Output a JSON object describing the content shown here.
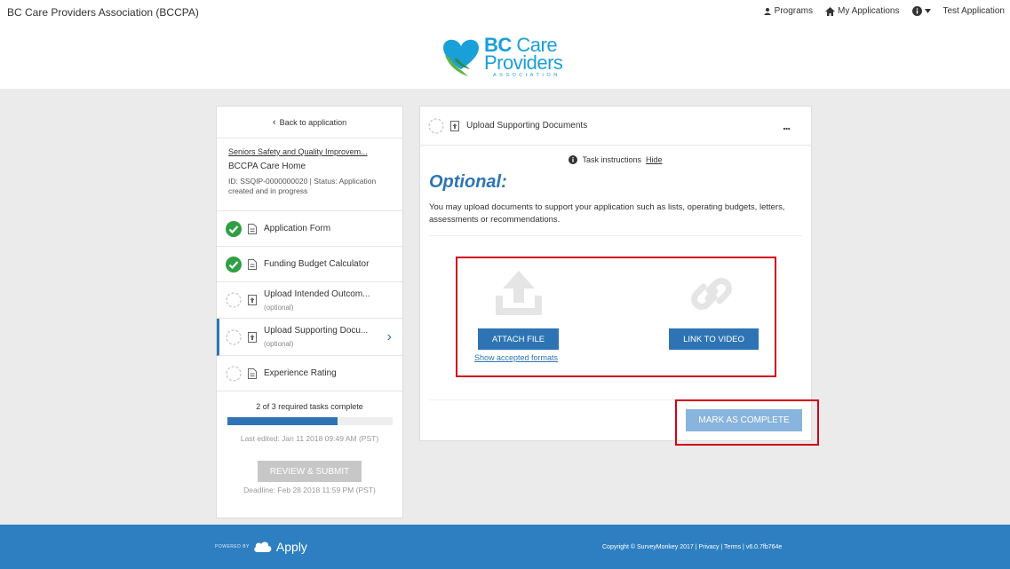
{
  "header": {
    "org_name": "BC Care Providers Association (BCCPA)",
    "nav": {
      "programs": "Programs",
      "my_applications": "My Applications",
      "account": "Test Application"
    },
    "logo": {
      "line1_bold": "BC",
      "line1_rest": "Care",
      "line2": "Providers",
      "line3": "ASSOCIATION"
    }
  },
  "sidebar": {
    "back_label": "Back to application",
    "program": "Seniors Safety and Quality Improvem...",
    "app_name": "BCCPA Care Home",
    "status": "ID: SSQIP-0000000020 | Status: Application created and in progress",
    "tasks": [
      {
        "label": "Application Form",
        "sub": "",
        "status": "complete"
      },
      {
        "label": "Funding Budget Calculator",
        "sub": "",
        "status": "complete"
      },
      {
        "label": "Upload Intended Outcom...",
        "sub": "(optional)",
        "status": "pending"
      },
      {
        "label": "Upload Supporting Docu...",
        "sub": "(optional)",
        "status": "pending",
        "active": true
      },
      {
        "label": "Experience Rating",
        "sub": "",
        "status": "pending"
      }
    ],
    "progress_text": "2 of 3 required tasks complete",
    "progress_fraction": 0.667,
    "last_edited": "Last edited: Jan 11 2018 09:49 AM (PST)",
    "review_label": "REVIEW & SUBMIT",
    "deadline": "Deadline: Feb 28 2018 11:59 PM (PST)"
  },
  "main": {
    "title": "Upload Supporting Documents",
    "more_label": "...",
    "instructions_label": "Task instructions",
    "hide_label": "Hide",
    "optional_heading": "Optional:",
    "description": "You may upload documents to support your application such as lists, operating budgets, letters, assessments or recommendations.",
    "attach_label": "ATTACH FILE",
    "formats_label": "Show accepted formats",
    "video_label": "LINK TO VIDEO",
    "complete_label": "MARK AS COMPLETE"
  },
  "footer": {
    "powered_by": "POWERED BY",
    "brand": "Apply",
    "copyright": "Copyright © SurveyMonkey 2017 | Privacy | Terms | v6.0.7fb764e"
  },
  "colors": {
    "primary": "#2e74b5",
    "footer": "#2e7fc1",
    "success": "#2ea043",
    "highlight": "#d0021b",
    "logo": "#1aa0d8"
  }
}
